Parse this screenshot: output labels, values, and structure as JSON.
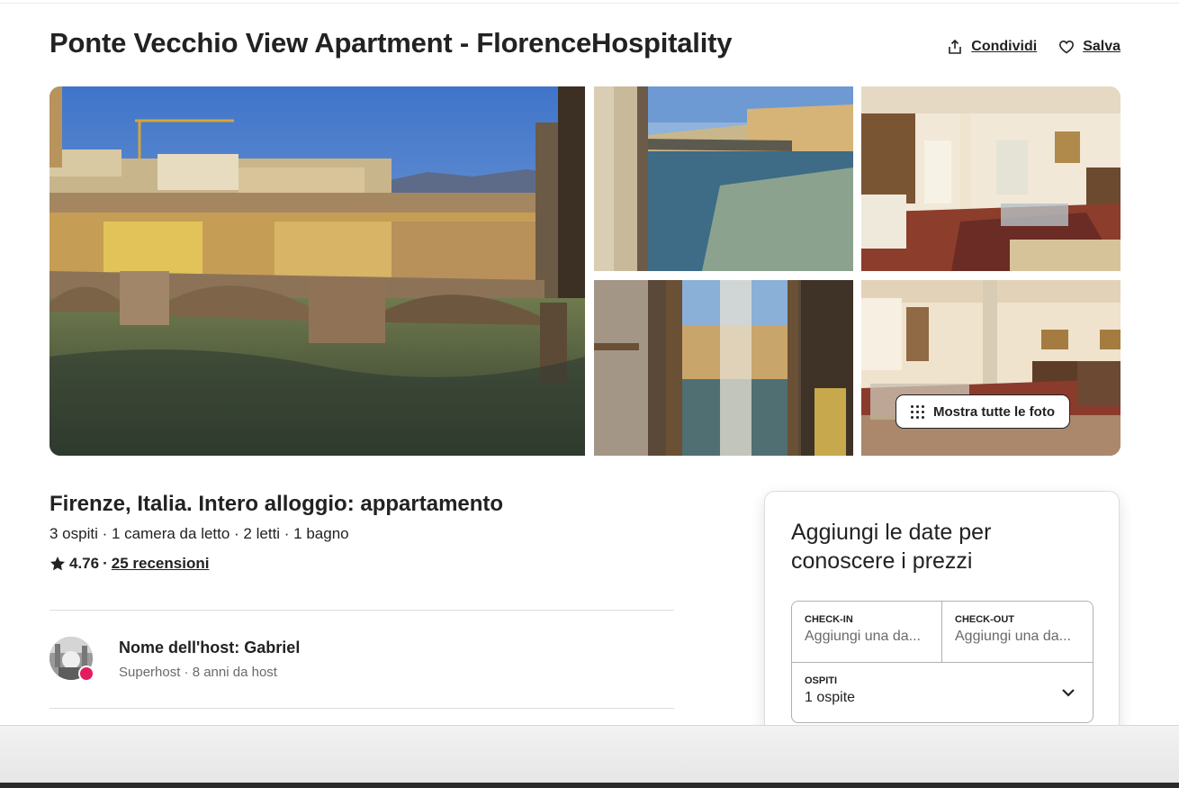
{
  "listing": {
    "title": "Ponte Vecchio View Apartment - FlorenceHospitality",
    "share_label": "Condividi",
    "save_label": "Salva",
    "show_all_label": "Mostra tutte le foto",
    "subtitle": "Firenze, Italia. Intero alloggio: appartamento",
    "details": "3 ospiti · 1 camera da letto · 2 letti · 1 bagno",
    "rating": "4.76",
    "rating_separator": "·",
    "reviews_label": "25 recensioni"
  },
  "host": {
    "name": "Nome dell'host: Gabriel",
    "meta": "Superhost · 8 anni da host"
  },
  "booking": {
    "title": "Aggiungi le date per conoscere i prezzi",
    "checkin_label": "CHECK-IN",
    "checkin_value": "Aggiungi una da...",
    "checkout_label": "CHECK-OUT",
    "checkout_value": "Aggiungi una da...",
    "guests_label": "OSPITI",
    "guests_value": "1 ospite"
  },
  "colors": {
    "text": "#222222",
    "muted": "#6a6a6a",
    "brand": "#e31c5f",
    "border": "#dddddd"
  },
  "icons": [
    "share-icon",
    "heart-icon",
    "grid-dots-icon",
    "star-icon",
    "chevron-down-icon"
  ]
}
